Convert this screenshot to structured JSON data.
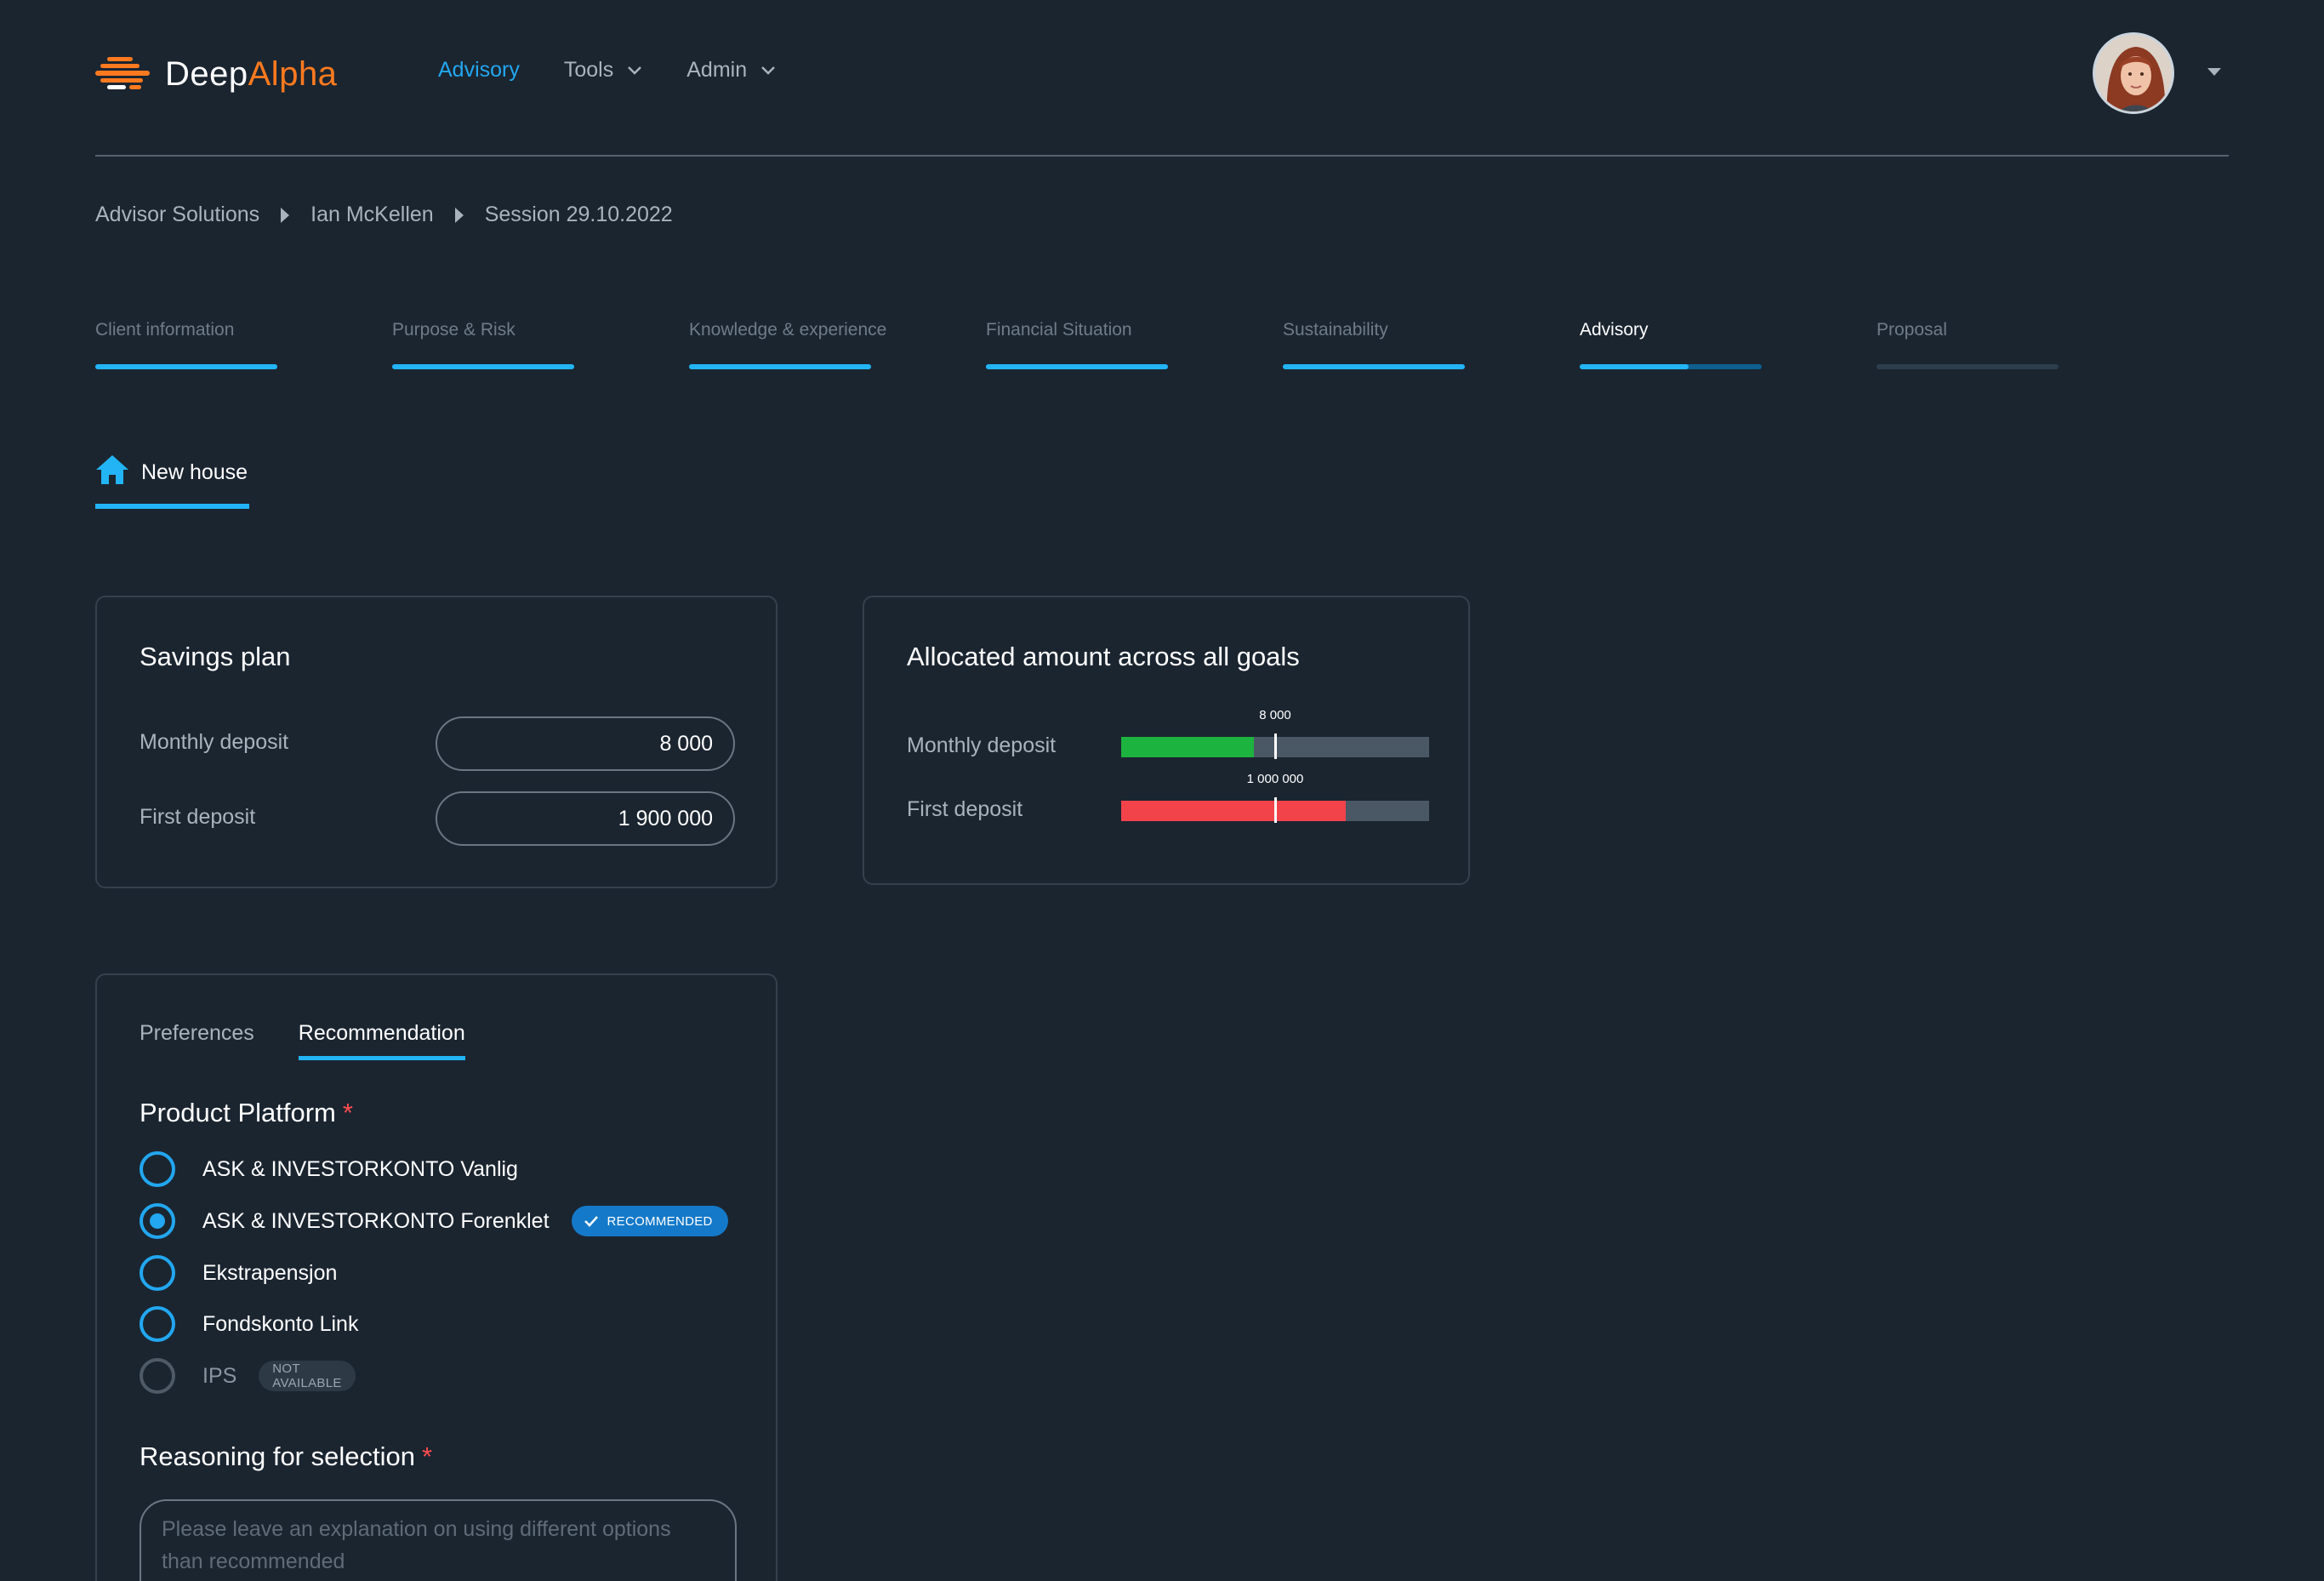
{
  "brand": {
    "name_part1": "Deep",
    "name_part2": "Alpha",
    "accent": "#ff7a1f"
  },
  "nav": [
    {
      "label": "Advisory",
      "active": true
    },
    {
      "label": "Tools",
      "dropdown": true
    },
    {
      "label": "Admin",
      "dropdown": true
    }
  ],
  "breadcrumb": [
    "Advisor Solutions",
    "Ian McKellen",
    "Session 29.10.2022"
  ],
  "steps": [
    {
      "label": "Client information",
      "progress": 1.0
    },
    {
      "label": "Purpose & Risk",
      "progress": 1.0
    },
    {
      "label": "Knowledge & experience",
      "progress": 1.0
    },
    {
      "label": "Financial Situation",
      "progress": 1.0
    },
    {
      "label": "Sustainability",
      "progress": 1.0
    },
    {
      "label": "Advisory",
      "progress": 0.6,
      "current": true
    },
    {
      "label": "Proposal",
      "progress": 0.0
    }
  ],
  "goal": {
    "label": "New house",
    "icon": "home-icon"
  },
  "savings_plan": {
    "title": "Savings plan",
    "monthly_label": "Monthly deposit",
    "monthly_value": "8 000",
    "first_label": "First deposit",
    "first_value": "1 900 000"
  },
  "allocated": {
    "title": "Allocated amount across all goals",
    "rows": [
      {
        "label": "Monthly deposit",
        "marker_label": "8 000",
        "fill": 0.43,
        "marker": 0.5,
        "color": "#1db33f"
      },
      {
        "label": "First deposit",
        "marker_label": "1 000 000",
        "fill": 0.73,
        "marker": 0.5,
        "color": "#f2434b"
      }
    ]
  },
  "recommendation": {
    "tabs": [
      {
        "label": "Preferences",
        "active": false
      },
      {
        "label": "Recommendation",
        "active": true
      }
    ],
    "platform_title": "Product Platform",
    "required_mark": "*",
    "options": [
      {
        "label": "ASK & INVESTORKONTO Vanlig",
        "selected": false
      },
      {
        "label": "ASK & INVESTORKONTO Forenklet",
        "selected": true,
        "badge": "RECOMMENDED"
      },
      {
        "label": "Ekstrapensjon",
        "selected": false
      },
      {
        "label": "Fondskonto Link",
        "selected": false
      },
      {
        "label": "IPS",
        "selected": false,
        "disabled": true,
        "badge": "NOT AVAILABLE"
      }
    ],
    "reasoning_title": "Reasoning for selection",
    "reasoning_placeholder": "Please leave an explanation on using different options than recommended"
  }
}
